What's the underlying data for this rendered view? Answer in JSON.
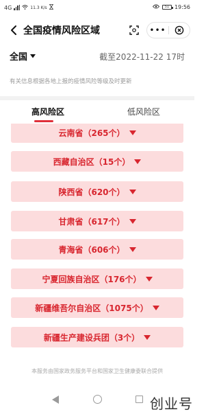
{
  "status_bar": {
    "network_left": "4G",
    "network_speed": "11.3 K/s",
    "battery": "51",
    "time": "19:56"
  },
  "nav": {
    "title": "全国疫情风险区域",
    "more_label": "•••"
  },
  "region": {
    "selected": "全国",
    "as_of": "截至2022-11-22 17时"
  },
  "notice": "有关信息根据各地上报的疫情风险等级及时更新",
  "tabs": [
    {
      "label": "高风险区",
      "active": true
    },
    {
      "label": "低风险区",
      "active": false
    }
  ],
  "provinces": [
    {
      "label": "云南省（265个）"
    },
    {
      "label": "西藏自治区（15个）"
    },
    {
      "label": "陕西省（620个）"
    },
    {
      "label": "甘肃省（617个）"
    },
    {
      "label": "青海省（606个）"
    },
    {
      "label": "宁夏回族自治区（176个）"
    },
    {
      "label": "新疆维吾尔自治区（1075个）"
    },
    {
      "label": "新疆生产建设兵团（3个）"
    }
  ],
  "footer": "本服务由国家政务服务平台和国家卫生健康委联合提供",
  "watermark": "创业号",
  "colors": {
    "accent": "#e0303a",
    "card_bg": "#fcdcdd",
    "card_text": "#d8262f"
  }
}
